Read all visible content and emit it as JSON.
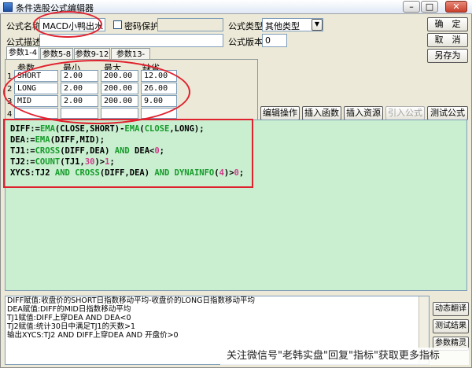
{
  "window": {
    "title": "条件选股公式编辑器"
  },
  "form": {
    "name_label": "公式名称",
    "name_value": "MACD小鸭出水",
    "password_label": "密码保护",
    "password_value": "",
    "type_label": "公式类型",
    "type_value": "其他类型",
    "desc_label": "公式描述",
    "desc_value": "",
    "version_label": "公式版本",
    "version_value": "0"
  },
  "side_buttons": {
    "ok": "确　定",
    "cancel": "取　消",
    "save_as": "另存为"
  },
  "tabs": [
    "参数1-4",
    "参数5-8",
    "参数9-12",
    "参数13-16"
  ],
  "params": {
    "headers": [
      "参数",
      "最小",
      "最大",
      "缺省"
    ],
    "rows": [
      {
        "no": "1",
        "name": "SHORT",
        "min": "2.00",
        "max": "200.00",
        "default": "12.00"
      },
      {
        "no": "2",
        "name": "LONG",
        "min": "2.00",
        "max": "200.00",
        "default": "26.00"
      },
      {
        "no": "3",
        "name": "MID",
        "min": "2.00",
        "max": "200.00",
        "default": "9.00"
      },
      {
        "no": "4",
        "name": "",
        "min": "",
        "max": "",
        "default": ""
      }
    ]
  },
  "toolbar": {
    "edit": "编辑操作",
    "insert_func": "插入函数",
    "insert_res": "插入资源",
    "ref_formula": "引入公式",
    "test": "测试公式"
  },
  "code": [
    "DIFF:=EMA(CLOSE,SHORT)-EMA(CLOSE,LONG);",
    "DEA:=EMA(DIFF,MID);",
    "TJ1:=CROSS(DIFF,DEA) AND DEA<0;",
    "TJ2:=COUNT(TJ1,30)>1;",
    "XYCS:TJ2 AND CROSS(DIFF,DEA) AND DYNAINFO(4)>0;"
  ],
  "code_tokens": {
    "l1": [
      "DIFF:=",
      "EMA",
      "(CLOSE,SHORT)-",
      "EMA",
      "(",
      "CLOSE",
      ",LONG);"
    ],
    "l2": [
      "DEA:=",
      "EMA",
      "(DIFF,MID);"
    ],
    "l3": [
      "TJ1:=",
      "CROSS",
      "(DIFF,DEA) ",
      "AND",
      " DEA<",
      "0",
      ";"
    ],
    "l4": [
      "TJ2:=",
      "COUNT",
      "(TJ1,",
      "30",
      ")>",
      "1",
      ";"
    ],
    "l5": [
      "XYCS:TJ2 ",
      "AND",
      " ",
      "CROSS",
      "(DIFF,DEA) ",
      "AND",
      " ",
      "DYNAINFO",
      "(",
      "4",
      ")>",
      "0",
      ";"
    ]
  },
  "explanation": [
    "DIFF赋值:收盘价的SHORT日指数移动平均-收盘价的LONG日指数移动平均",
    "DEA赋值:DIFF的MID日指数移动平均",
    "TJ1赋值:DIFF上穿DEA AND DEA<0",
    "TJ2赋值:统计30日中满足TJ1的天数>1",
    "输出XYCS:TJ2 AND DIFF上穿DEA AND 开盘价>0"
  ],
  "right_buttons": {
    "translate": "动态翻译",
    "test_result": "测试结果",
    "param_wizard": "参数精灵"
  },
  "watermark": "关注微信号\"老韩实盘\"回复\"指标\"获取更多指标"
}
